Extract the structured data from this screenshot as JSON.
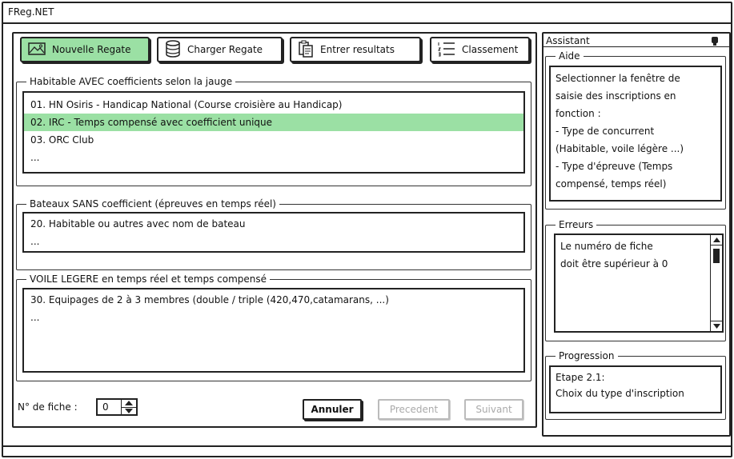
{
  "app": {
    "title": "FReg.NET"
  },
  "toolbar": {
    "new_label": "Nouvelle Regate",
    "load_label": "Charger Regate",
    "enter_label": "Entrer resultats",
    "rank_label": "Classement"
  },
  "groups": [
    {
      "legend": "Habitable AVEC coefficients selon la jauge",
      "items": [
        "01. HN Osiris - Handicap National (Course croisière au Handicap)",
        "02. IRC - Temps compensé avec coefficient unique",
        "03. ORC Club",
        "..."
      ],
      "selected_index": 1
    },
    {
      "legend": "Bateaux SANS coefficient (épreuves en temps réel)",
      "items": [
        "20. Habitable ou autres avec nom de bateau",
        "..."
      ]
    },
    {
      "legend": "VOILE LEGERE en temps réel et temps compensé",
      "items": [
        "30. Equipages de 2 à 3 membres (double / triple (420,470,catamarans, ...)",
        "..."
      ]
    }
  ],
  "footer": {
    "fiche_label": "N° de fiche :",
    "fiche_value": "0",
    "cancel_label": "Annuler",
    "prev_label": "Precedent",
    "next_label": "Suivant"
  },
  "assistant": {
    "title": "Assistant",
    "aide_legend": "Aide",
    "aide_lines": [
      "Selectionner la fenêtre de",
      "saisie des inscriptions en",
      "fonction :",
      "- Type de concurrent",
      "(Habitable, voile légère ...)",
      "- Type d'épreuve (Temps",
      "compensé, temps réel)"
    ],
    "erreurs_legend": "Erreurs",
    "erreurs_lines": [
      "Le numéro de fiche",
      "doit être supérieur à 0"
    ],
    "progression_legend": "Progression",
    "progression_lines": [
      "Etape 2.1:",
      "Choix du type d'inscription"
    ]
  },
  "colors": {
    "selection": "#9be0a4",
    "border": "#222222",
    "disabled": "#aaaaaa"
  }
}
